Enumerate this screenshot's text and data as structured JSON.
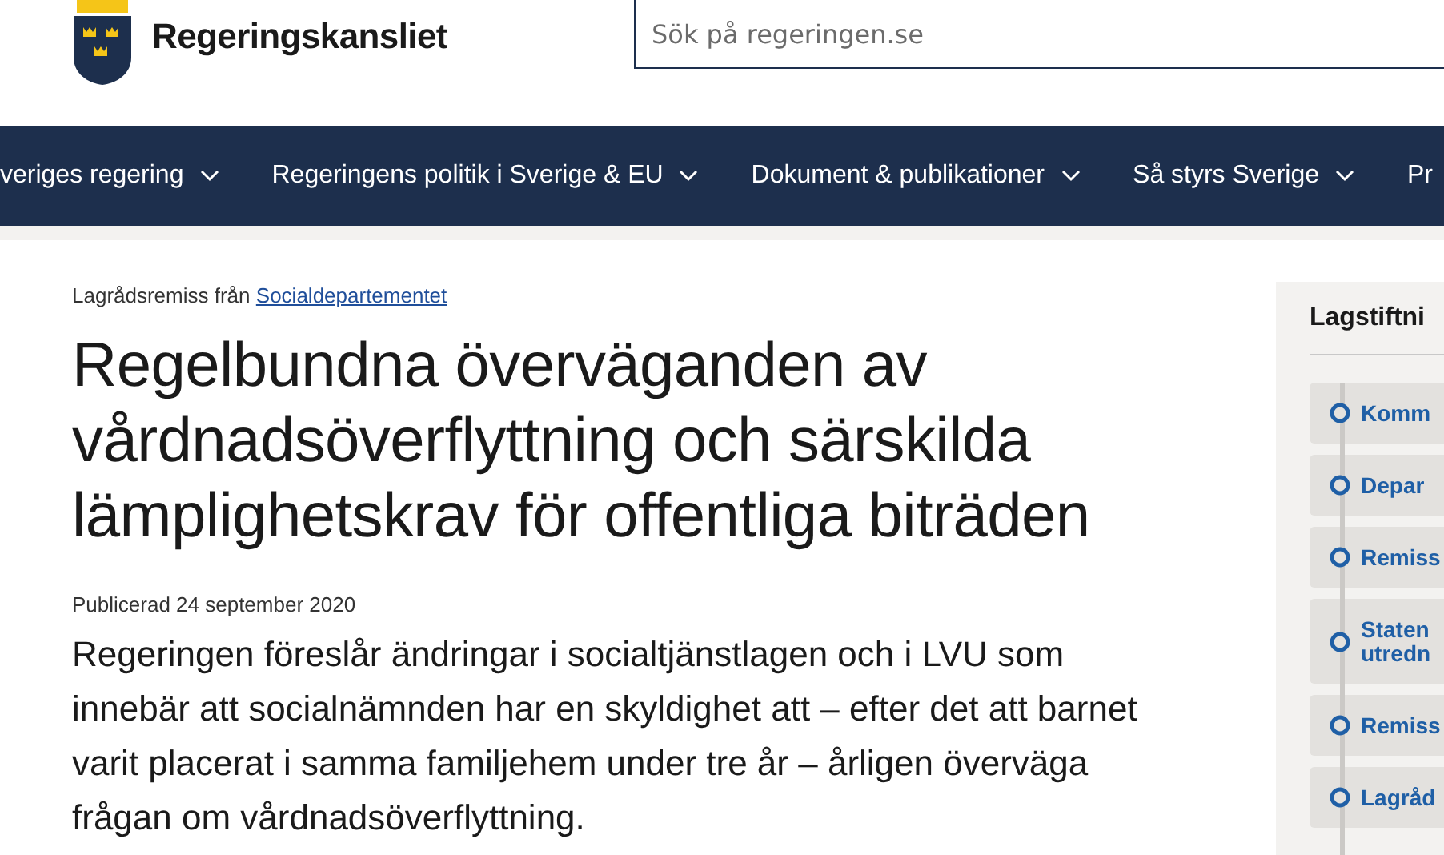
{
  "header": {
    "site_name": "Regeringskansliet",
    "search": {
      "placeholder": "Sök på regeringen.se"
    }
  },
  "nav": {
    "items": [
      {
        "label": "veriges regering",
        "has_menu": true
      },
      {
        "label": "Regeringens politik i Sverige & EU",
        "has_menu": true
      },
      {
        "label": "Dokument & publikationer",
        "has_menu": true
      },
      {
        "label": "Så styrs Sverige",
        "has_menu": true
      },
      {
        "label": "Pr"
      }
    ]
  },
  "article": {
    "breadcrumb_prefix": "Lagrådsremiss från",
    "breadcrumb_link": "Socialdepartementet",
    "title": "Regelbundna överväganden av vårdnadsöverflyttning och särskilda lämplighetskrav för offentliga biträden",
    "published": "Publicerad 24 september 2020",
    "lead": "Regeringen föreslår ändringar i socialtjänstlagen och i LVU som innebär att socialnämnden har en skyldighet att – efter det att barnet varit placerat i samma familjehem under tre år – årligen överväga frågan om vårdnadsöverflyttning."
  },
  "sidebar": {
    "title": "Lagstiftni",
    "steps": [
      {
        "label": "Komm"
      },
      {
        "label": "Depar"
      },
      {
        "label": "Remiss"
      },
      {
        "label": "Staten\nutredn"
      },
      {
        "label": "Remiss"
      },
      {
        "label": "Lagråd"
      }
    ]
  }
}
